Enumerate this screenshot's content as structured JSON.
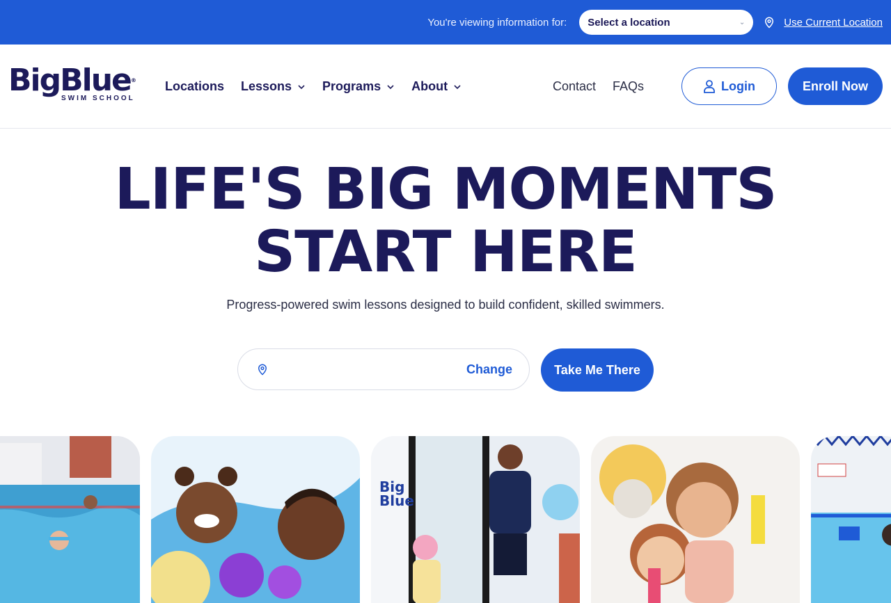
{
  "topbar": {
    "viewing_text": "You're viewing information for:",
    "location_select": "Select a location",
    "use_current_location": "Use Current Location"
  },
  "header": {
    "logo": {
      "word": "BigBlue",
      "sub": "SWIM SCHOOL"
    },
    "nav_left": [
      "Locations",
      "Lessons",
      "Programs",
      "About"
    ],
    "nav_right": [
      "Contact",
      "FAQs"
    ],
    "login_label": "Login",
    "enroll_label": "Enroll Now"
  },
  "hero": {
    "title_line1": "LIFE'S BIG MOMENTS",
    "title_line2": "START HERE",
    "subtitle": "Progress-powered swim lessons designed to build confident, skilled swimmers.",
    "search_placeholder": "",
    "change_label": "Change",
    "cta_label": "Take Me There"
  },
  "photos": [
    {
      "name": "pool-swimmers-photo"
    },
    {
      "name": "toddler-and-dad-photo"
    },
    {
      "name": "instructor-photo"
    },
    {
      "name": "kids-with-ribbons-photo"
    },
    {
      "name": "pool-lanes-photo"
    }
  ],
  "colors": {
    "brand_blue": "#1f5bd6",
    "navy": "#1c1a5a"
  }
}
